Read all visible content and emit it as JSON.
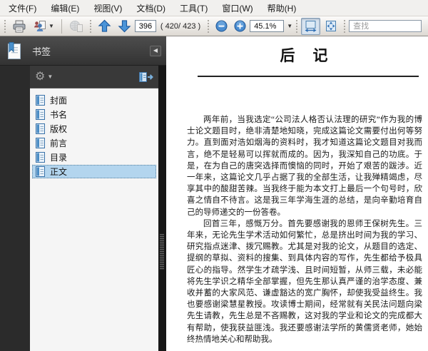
{
  "menubar": {
    "items": [
      "文件(F)",
      "编辑(E)",
      "视图(V)",
      "文档(D)",
      "工具(T)",
      "窗口(W)",
      "帮助(H)"
    ]
  },
  "toolbar": {
    "page_number": "396",
    "page_count_label": "( 420/ 423 )",
    "zoom_level": "45.1%",
    "find_placeholder": "查找",
    "icons": [
      "print-icon",
      "collaborate-icon",
      "share-online-icon",
      "arrow-up-icon",
      "arrow-down-icon",
      "zoom-out-icon",
      "zoom-in-icon",
      "fit-width-icon",
      "fit-page-icon"
    ]
  },
  "sidebar": {
    "panel_title": "书签",
    "options_icon": "gear-icon",
    "expand_icon": "goto-bookmark-icon",
    "bookmarks": [
      {
        "label": "封面",
        "selected": false
      },
      {
        "label": "书名",
        "selected": false
      },
      {
        "label": "版权",
        "selected": false
      },
      {
        "label": "前言",
        "selected": false
      },
      {
        "label": "目录",
        "selected": false
      },
      {
        "label": "正文",
        "selected": true
      }
    ]
  },
  "document": {
    "title": "后　记",
    "paragraphs": [
      "两年前，当我选定“公司法人格否认法理的研究”作为我的博士论文题目时，绝非清楚地知晓，完成这篇论文需要付出何等努力。直到面对浩如烟海的资料时，我才知道这篇论文题目对我而言，绝不是轻易可以挥就而成的。因为，我深知自己的功底。于是，在为自己的唐突选择而懊恼的同时，开始了艰苦的跋涉。近一年来，这篇论文几乎占据了我的全部生活，让我殚精竭虑，尽享其中的酸甜苦辣。当我终于能为本文打上最后一个句号时，欣喜之情自不待言。这是我三年学海生涯的总结，是向辛勤培育自己的导师递交的一份答卷。",
      "回首三年，感慨万分。首先要感谢我的恩师王保树先生。三年来，无论先生学术活动如何繁忙，总是挤出时间为我的学习、研究指点迷津、拨冗赐教。尤其是对我的论文，从题目的选定、提纲的草拟、资料的搜集、到具体内容的写作，先生都给予极具匠心的指导。然学生才疏学浅、且时间短暂，从师三载，未必能将先生学识之精华全部掌握，但先生那认真严谨的治学态度、兼收并蓄的大家风范、谦虚豁达的宽广胸怀，却使我受益终生。我也要感谢梁慧星教授。攻读博士期间，经常就有关民法问题向梁先生请教，先生总是不吝赐教，这对我的学业和论文的完成都大有帮助，使我获益匪浅。我还要感谢法学所的黄儒贤老师，她始终热情地关心和帮助我。"
    ]
  },
  "colors": {
    "accent_blue": "#3f86c6",
    "selection_blue": "#b3d5ee",
    "sidebar_dark": "#2f2f2f",
    "toolbar_gray": "#e4e1db",
    "page_background": "#ffffff"
  }
}
